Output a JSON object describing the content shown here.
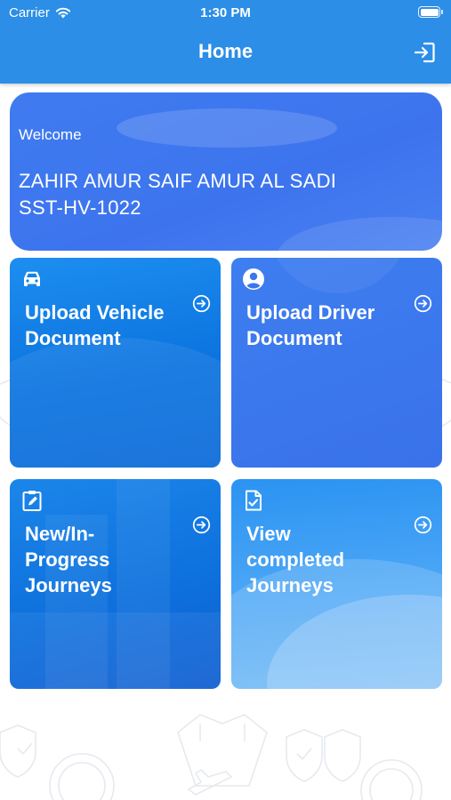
{
  "status_bar": {
    "carrier": "Carrier",
    "time": "1:30 PM"
  },
  "header": {
    "title": "Home",
    "logout_icon": "logout-icon"
  },
  "welcome": {
    "label": "Welcome",
    "name": "ZAHIR AMUR SAIF AMUR AL SADI",
    "id": "SST-HV-1022"
  },
  "tiles": [
    {
      "label": "Upload Vehicle Document",
      "icon": "car-icon"
    },
    {
      "label": "Upload Driver Document",
      "icon": "person-circle-icon"
    },
    {
      "label": "New/In-Progress Journeys",
      "icon": "clipboard-edit-icon"
    },
    {
      "label": "View completed Journeys",
      "icon": "document-check-icon"
    }
  ],
  "colors": {
    "header": "#2c8ee6",
    "welcome_card": "#3f7bf0",
    "tile_blue": "#0c74df",
    "tile_indigo": "#3a72ea"
  }
}
